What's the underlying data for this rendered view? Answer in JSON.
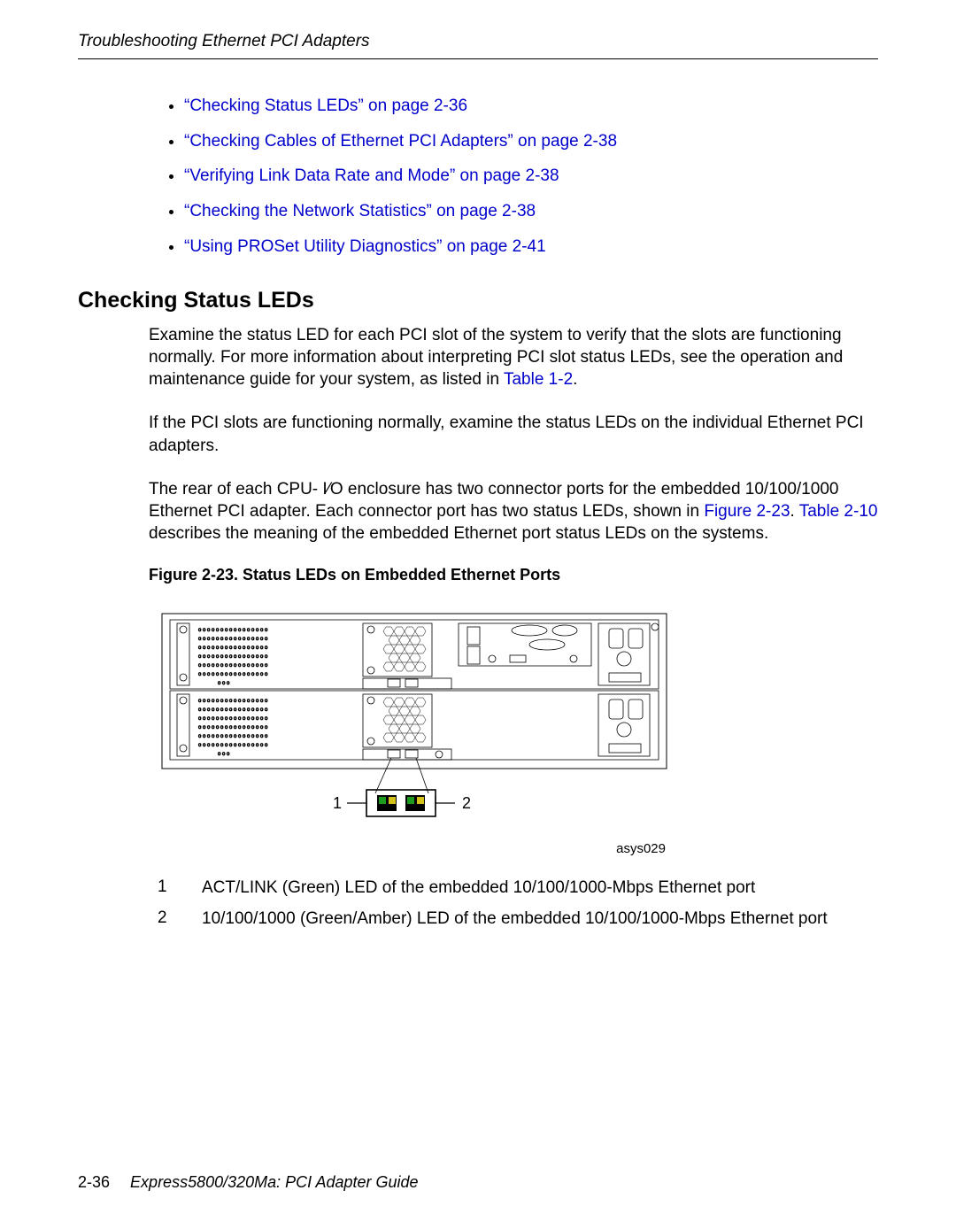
{
  "header": {
    "title": "Troubleshooting Ethernet PCI Adapters"
  },
  "toc": {
    "items": [
      "“Checking Status LEDs” on page 2-36",
      "“Checking Cables of Ethernet PCI Adapters” on page 2-38",
      "“Verifying Link Data Rate and Mode” on page 2-38",
      "“Checking the Network Statistics” on page 2-38",
      "“Using PROSet Utility Diagnostics” on page 2-41"
    ]
  },
  "section": {
    "heading": "Checking Status LEDs"
  },
  "para1": {
    "pre": "Examine the status LED for each PCI slot of the system to verify that the slots are functioning normally. For more information about interpreting PCI slot status LEDs, see the operation and maintenance guide for your system, as listed in ",
    "xref": "Table 1-2",
    "post": "."
  },
  "para2": "If the PCI slots are functioning normally, examine the status LEDs on the individual Ethernet PCI adapters.",
  "para3": {
    "a": "The rear of each CPU- I⁄O enclosure has two connector ports for the embedded 10/100/1000 Ethernet PCI adapter. Each connector port has two status LEDs, shown in ",
    "x1": "Figure 2-23",
    "b": ". ",
    "x2": "Table 2-10",
    "c": " describes the meaning of the embedded Ethernet port status LEDs on the systems."
  },
  "figure": {
    "title": "Figure 2-23. Status LEDs on Embedded Ethernet Ports",
    "id": "asys029",
    "callouts": {
      "c1": "1",
      "c2": "2"
    }
  },
  "legend": {
    "rows": [
      {
        "n": "1",
        "t": "ACT/LINK (Green) LED of the embedded 10/100/1000-Mbps Ethernet port"
      },
      {
        "n": "2",
        "t": "10/100/1000 (Green/Amber) LED of the embedded 10/100/1000-Mbps Ethernet port"
      }
    ]
  },
  "footer": {
    "pagenum": "2-36",
    "title": "Express5800/320Ma: PCI Adapter Guide"
  }
}
